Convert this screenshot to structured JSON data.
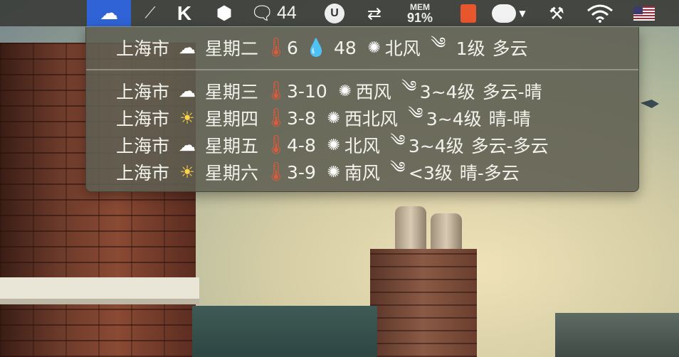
{
  "menubar": {
    "weather_icon": "cloud-icon",
    "status_count": "44",
    "mem_label": "MEM",
    "mem_value": "91%"
  },
  "menu": {
    "today": {
      "city": "上海市",
      "condition_icon": "cloud-icon",
      "day": "星期二",
      "temp": "6",
      "humidity": "48",
      "wind_dir": "北风",
      "wind_level": "1级",
      "weather": "多云"
    },
    "forecast": [
      {
        "city": "上海市",
        "condition_icon": "cloud-icon",
        "day": "星期三",
        "temp": "3-10",
        "wind_dir": "西风",
        "wind_level": "3~4级",
        "weather": "多云-晴"
      },
      {
        "city": "上海市",
        "condition_icon": "sun-icon",
        "day": "星期四",
        "temp": "3-8",
        "wind_dir": "西北风",
        "wind_level": "3~4级",
        "weather": "晴-晴"
      },
      {
        "city": "上海市",
        "condition_icon": "cloud-icon",
        "day": "星期五",
        "temp": "4-8",
        "wind_dir": "北风",
        "wind_level": "3~4级",
        "weather": "多云-多云"
      },
      {
        "city": "上海市",
        "condition_icon": "sun-icon",
        "day": "星期六",
        "temp": "3-9",
        "wind_dir": "南风",
        "wind_level": "<3级",
        "weather": "晴-多云"
      }
    ]
  }
}
